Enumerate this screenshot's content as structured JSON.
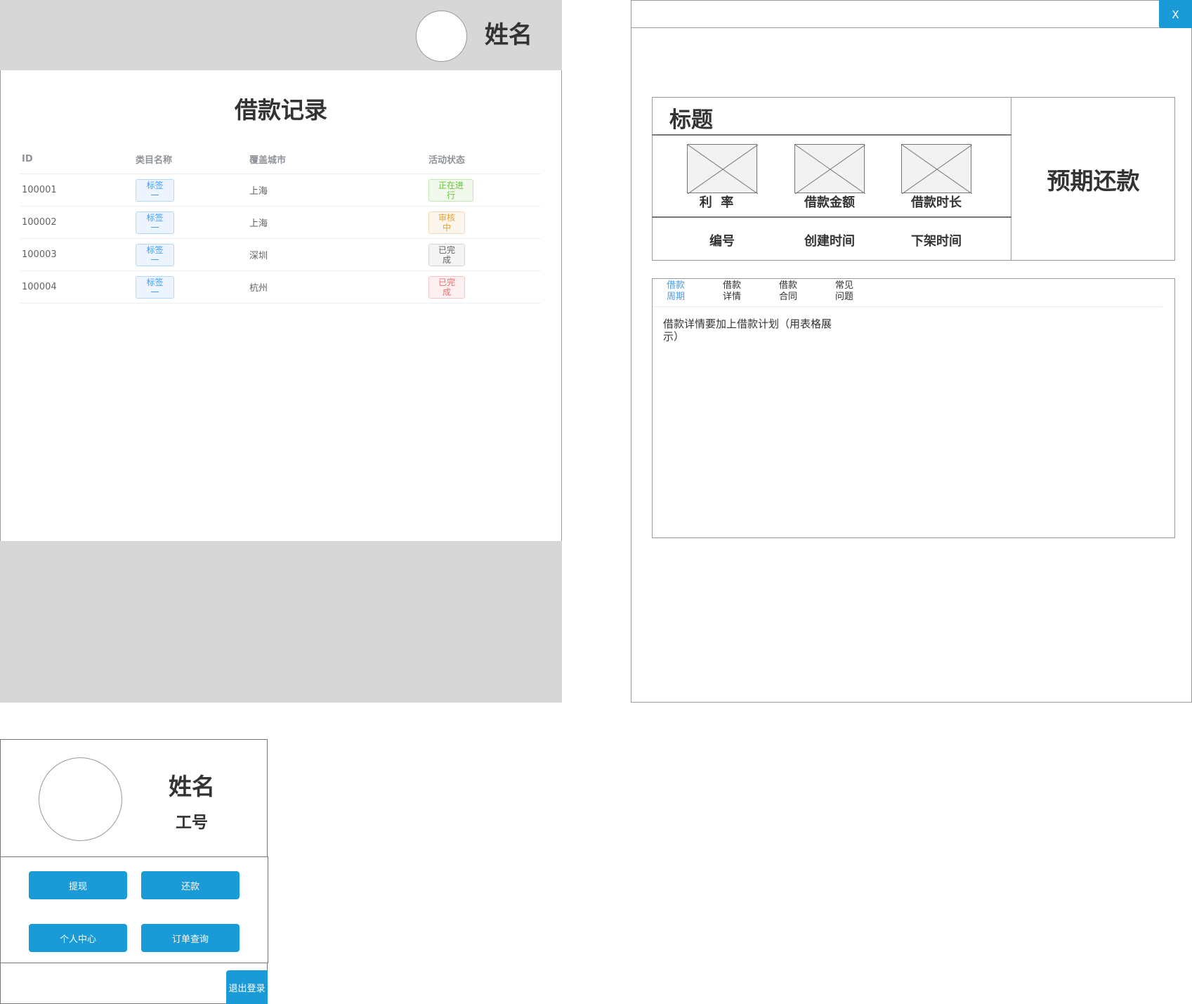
{
  "records_panel": {
    "user_name": "姓名",
    "title": "借款记录",
    "columns": [
      "ID",
      "类目名称",
      "覆盖城市",
      "活动状态"
    ],
    "rows": [
      {
        "id": "100001",
        "category": "标签一",
        "city": "上海",
        "status": "正在进行",
        "status_type": "success"
      },
      {
        "id": "100002",
        "category": "标签一",
        "city": "上海",
        "status": "审核中",
        "status_type": "warning"
      },
      {
        "id": "100003",
        "category": "标签一",
        "city": "深圳",
        "status": "已完成",
        "status_type": "info"
      },
      {
        "id": "100004",
        "category": "标签一",
        "city": "杭州",
        "status": "已完成",
        "status_type": "danger"
      }
    ]
  },
  "detail_panel": {
    "close_label": "X",
    "title": "标题",
    "metrics": [
      "利  率",
      "借款金额",
      "借款时长"
    ],
    "meta": [
      "编号",
      "创建时间",
      "下架时间"
    ],
    "expected_repayment": "预期还款",
    "tabs": [
      {
        "label": "借款周期",
        "active": true
      },
      {
        "label": "借款详情",
        "active": false
      },
      {
        "label": "借款合同",
        "active": false
      },
      {
        "label": "常见问题",
        "active": false
      }
    ],
    "tab_content": "借款详情要加上借款计划（用表格展示）"
  },
  "profile_panel": {
    "name": "姓名",
    "employee_id": "工号",
    "buttons": [
      "提现",
      "还款",
      "个人中心",
      "订单查询"
    ],
    "logout_label": "退出登录"
  },
  "colors": {
    "primary": "#1a9bd7",
    "header_gray": "#d7d7d7",
    "tag_blue": "#409eff",
    "success": "#67c23a",
    "warning": "#e6a23c",
    "danger": "#f56c6c"
  }
}
